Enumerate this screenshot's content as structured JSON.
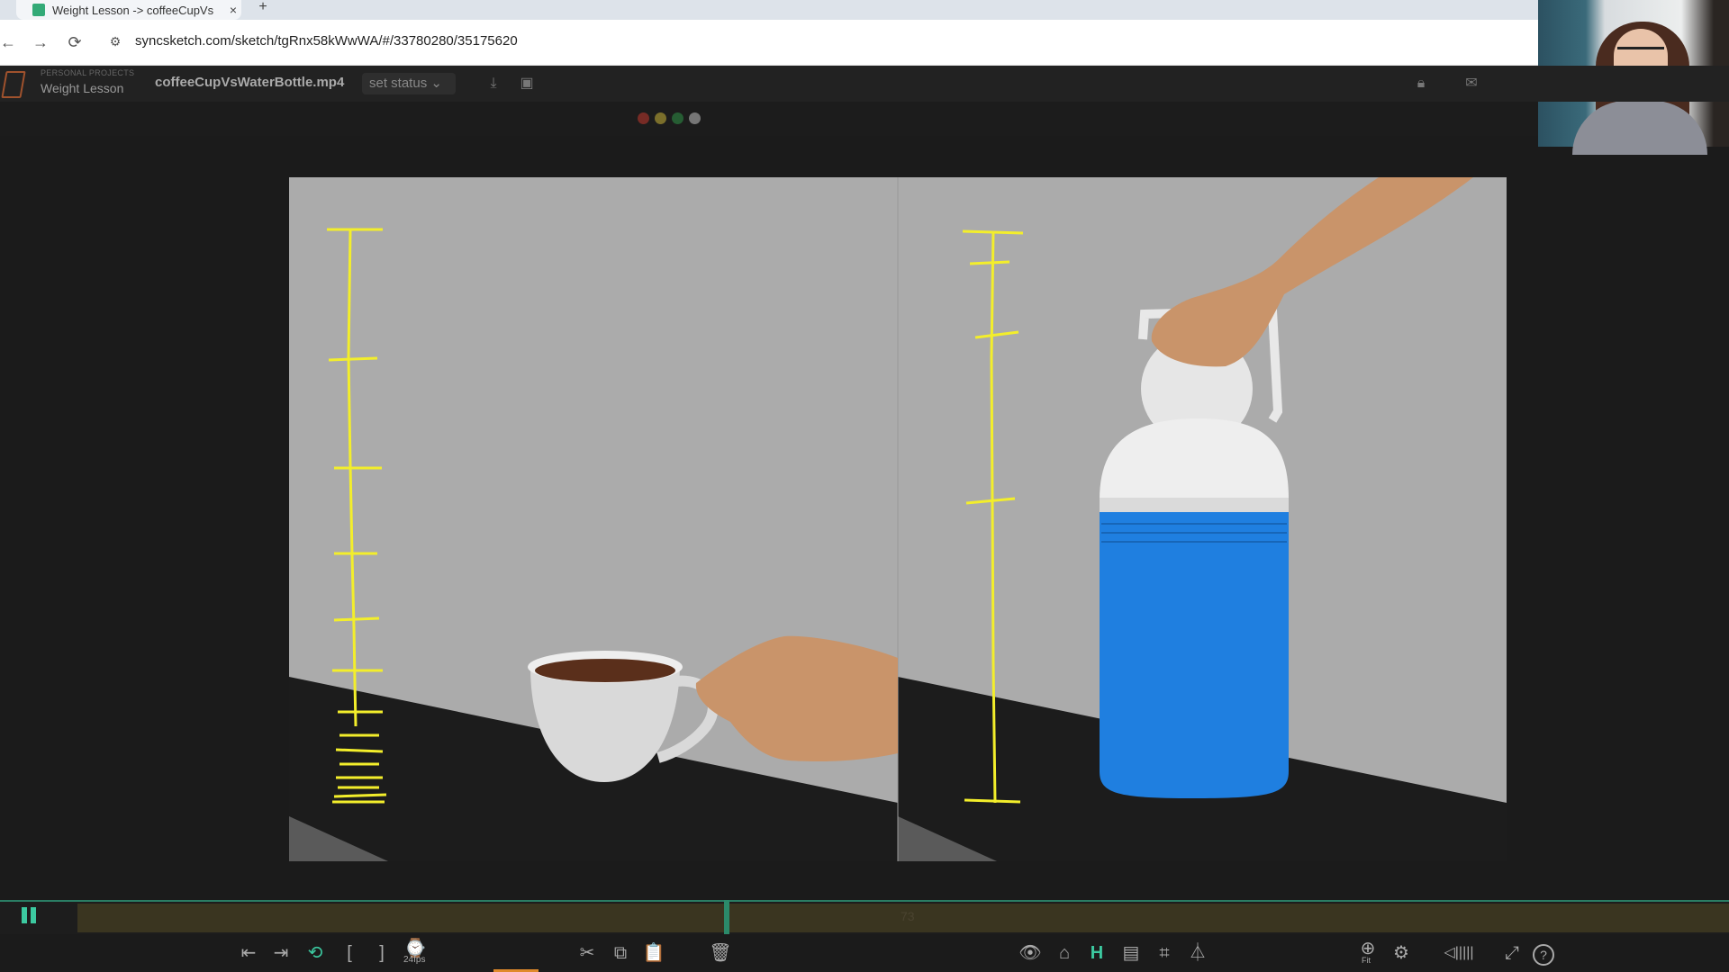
{
  "browser": {
    "tab_title": "Weight Lesson -> coffeeCupVs",
    "tab_close": "×",
    "new_tab": "+",
    "url": "syncsketch.com/sketch/tgRnx58kWwWA/#/33780280/35175620",
    "nav": {
      "back": "←",
      "forward": "→",
      "reload": "⟳",
      "tune": "⚙"
    }
  },
  "app": {
    "project_label": "PERSONAL PROJECTS",
    "project_name": "Weight Lesson",
    "file_name": "coffeeCupVsWaterBottle.mp4",
    "status_label": "set status",
    "header_icons": [
      "download-icon",
      "image-icon",
      "lock-icon",
      "mail-icon"
    ]
  },
  "toolbar": {
    "colors": [
      "#d23a2e",
      "#d9c23a",
      "#2f9d4a",
      "#cfcfcf"
    ]
  },
  "timeline": {
    "frame": "73",
    "playhead_fraction": 0.43
  },
  "bottom_controls": {
    "fps": "24fps",
    "zoom_label": "Fit",
    "icons": {
      "first_frame": "⇤",
      "last_frame": "⇥",
      "loop": "⟲",
      "in_point": "[",
      "out_point": "]",
      "speed": "⌚",
      "cut": "✂",
      "copy": "⧉",
      "paste": "📋",
      "trash": "🗑",
      "eye": "👁",
      "onion": "⌂",
      "h": "H",
      "grid": "▤",
      "crop": "⌗",
      "mirror": "⏃",
      "zoom": "⊕",
      "settings": "⚙",
      "volume": "◁|||||",
      "fullscreen": "⤢",
      "help": "?"
    },
    "accent": "#3cc9a0"
  }
}
